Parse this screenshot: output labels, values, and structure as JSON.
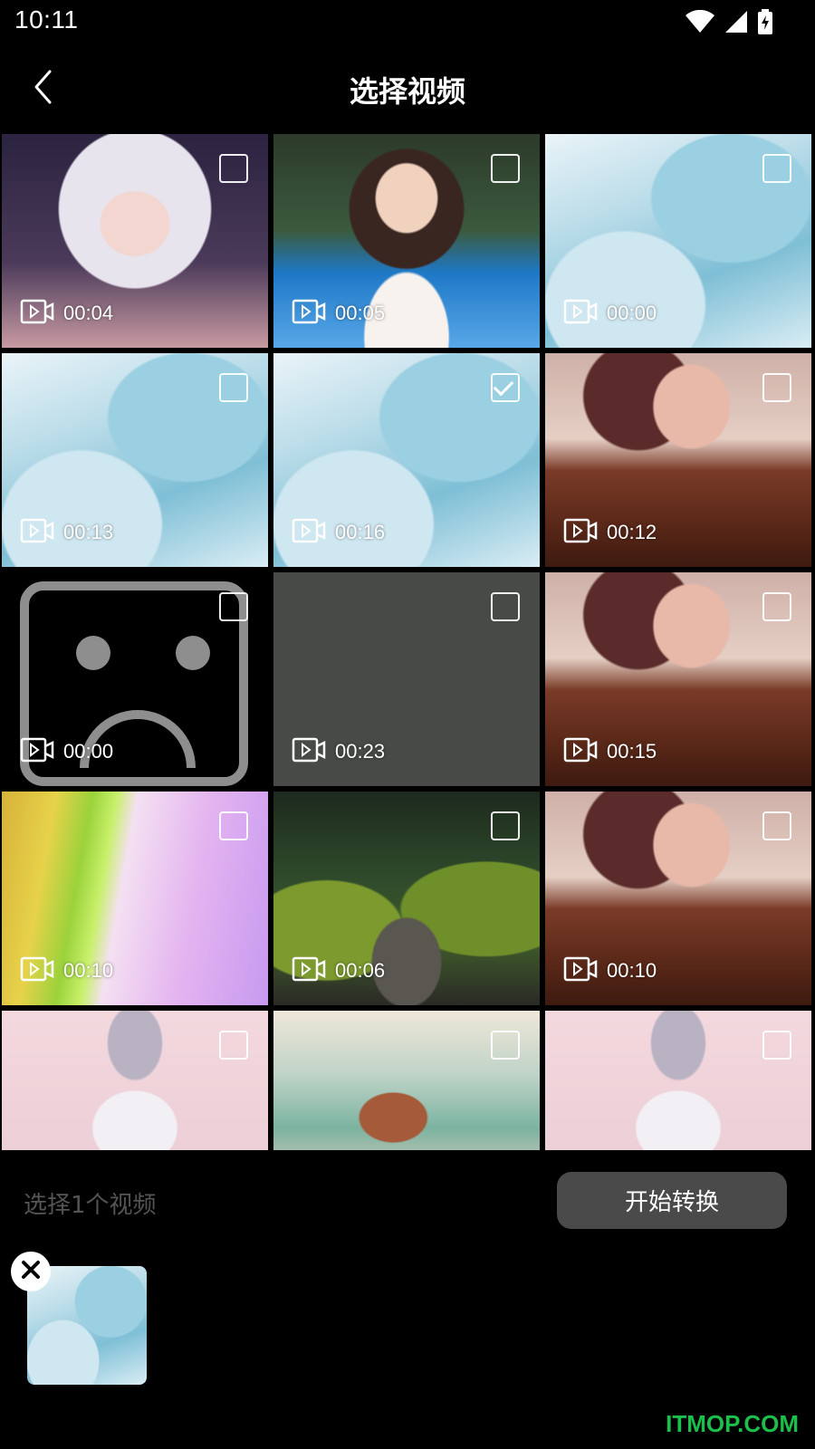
{
  "status": {
    "time": "10:11"
  },
  "header": {
    "title": "选择视频"
  },
  "videos": [
    {
      "duration": "00:04",
      "checked": false,
      "thumb": "t-goddess"
    },
    {
      "duration": "00:05",
      "checked": false,
      "thumb": "t-portrait"
    },
    {
      "duration": "00:00",
      "checked": false,
      "thumb": "t-ice"
    },
    {
      "duration": "00:13",
      "checked": false,
      "thumb": "t-ice"
    },
    {
      "duration": "00:16",
      "checked": true,
      "thumb": "t-ice"
    },
    {
      "duration": "00:12",
      "checked": false,
      "thumb": "t-girl"
    },
    {
      "duration": "00:00",
      "checked": false,
      "thumb": "t-sad"
    },
    {
      "duration": "00:23",
      "checked": false,
      "thumb": "t-gray"
    },
    {
      "duration": "00:15",
      "checked": false,
      "thumb": "t-girl"
    },
    {
      "duration": "00:10",
      "checked": false,
      "thumb": "t-rainbow"
    },
    {
      "duration": "00:06",
      "checked": false,
      "thumb": "t-forest"
    },
    {
      "duration": "00:10",
      "checked": false,
      "thumb": "t-girl"
    },
    {
      "duration": "",
      "checked": false,
      "thumb": "t-dancer"
    },
    {
      "duration": "",
      "checked": false,
      "thumb": "t-anime"
    },
    {
      "duration": "",
      "checked": false,
      "thumb": "t-dancer"
    }
  ],
  "footer": {
    "selected_count": "选择1个视频",
    "start_button": "开始转换"
  },
  "watermark": "ITMOP.COM",
  "icons": {
    "back": "back-arrow-icon",
    "video": "video-icon",
    "remove": "remove-x-icon",
    "wifi": "wifi-icon",
    "signal": "signal-icon",
    "battery": "battery-charging-icon"
  }
}
